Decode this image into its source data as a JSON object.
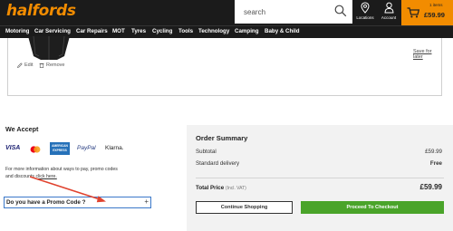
{
  "header": {
    "logo": "halfords",
    "search_placeholder": "search",
    "locations_label": "Locations",
    "account_label": "Account",
    "basket_items": "1 items",
    "basket_total": "£59.99"
  },
  "nav": {
    "items": [
      "Motoring",
      "Car Servicing",
      "Car Repairs",
      "MOT",
      "Tyres",
      "Cycling",
      "Tools",
      "Technology",
      "Camping",
      "Baby & Child"
    ]
  },
  "product": {
    "edit_label": "Edit",
    "remove_label": "Remove",
    "save_for_later_label": "Save for later"
  },
  "payment": {
    "title": "We Accept",
    "methods": [
      "VISA",
      "Mastercard",
      "AMERICAN EXPRESS",
      "PayPal",
      "Klarna."
    ],
    "info_text": "For more information about ways to pay, promo codes and discounts ",
    "info_link": "click here.",
    "promo_label": "Do you have a Promo Code ?",
    "promo_toggle": "+"
  },
  "summary": {
    "title": "Order Summary",
    "subtotal_label": "Subtotal",
    "subtotal_value": "£59.99",
    "delivery_label": "Standard delivery",
    "delivery_value": "Free",
    "total_label": "Total Price",
    "total_vat_note": "(Incl. VAT)",
    "total_value": "£59.99",
    "continue_label": "Continue Shopping",
    "checkout_label": "Proceed To Checkout"
  },
  "colors": {
    "brand_orange": "#f28c00",
    "header_dark": "#1b1b1b",
    "checkout_green": "#4aa42a",
    "annotation_red": "#e0432f",
    "promo_border": "#3a78c9"
  }
}
